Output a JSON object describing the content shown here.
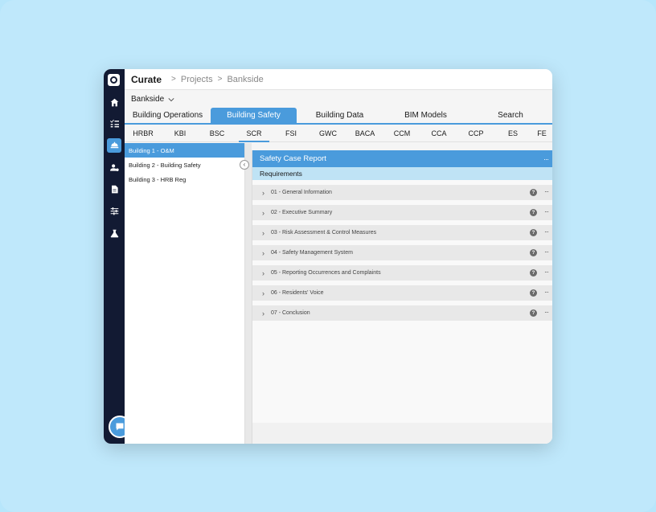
{
  "app": {
    "title": "Curate"
  },
  "breadcrumb": {
    "items": [
      "Projects",
      "Bankside"
    ],
    "separator": ">"
  },
  "project": {
    "selected": "Bankside"
  },
  "main_tabs": [
    {
      "label": "Building Operations"
    },
    {
      "label": "Building Safety",
      "active": true
    },
    {
      "label": "Building Data"
    },
    {
      "label": "BIM Models"
    },
    {
      "label": "Search"
    }
  ],
  "sub_tabs": [
    "HRBR",
    "KBI",
    "BSC",
    "SCR",
    "FSI",
    "GWC",
    "BACA",
    "CCM",
    "CCA",
    "CCP",
    "ES",
    "FE"
  ],
  "sub_tabs_active": "SCR",
  "tree": {
    "items": [
      "Building 1 - O&M",
      "Building 2 - Building Safety",
      "Building 3 - HRB Reg"
    ],
    "active_index": 0
  },
  "report": {
    "title": "Safety Case Report",
    "requirements_label": "Requirements",
    "items": [
      "01 - General Information",
      "02 - Executive Summary",
      "03 - Risk Assessment & Control Measures",
      "04 - Safety Management System",
      "05 - Reporting Occurrences and Complaints",
      "06 - Residents' Voice",
      "07 - Conclusion"
    ]
  },
  "icons": {
    "sidebar": [
      "home-icon",
      "checklist-icon",
      "building-icon",
      "user-settings-icon",
      "document-icon",
      "sliders-icon",
      "flask-icon"
    ],
    "help": "?",
    "more": "···"
  },
  "colors": {
    "accent": "#4a9bdc",
    "rail": "#121a33",
    "background": "#b7e6fb"
  }
}
